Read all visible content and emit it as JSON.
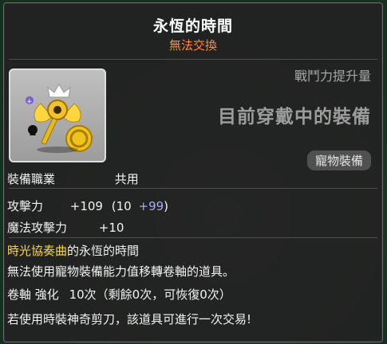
{
  "title": "永恆的時間",
  "subtitle": "無法交換",
  "power_label": "戰鬥力提升量",
  "equip_status": "目前穿戴中的裝備",
  "category_badge": "寵物裝備",
  "job": {
    "label": "裝備職業",
    "value": "共用"
  },
  "attack": {
    "label": "攻擊力",
    "total": "+109",
    "base": "(10",
    "bonus": "+99",
    "close": ")"
  },
  "magic": {
    "label": "魔法攻擊力",
    "value": "+10"
  },
  "set_line": {
    "highlight": "時光協奏曲",
    "rest": "的永恆的時間"
  },
  "description": "無法使用寵物裝備能力值移轉卷軸的道具。",
  "upgrade": {
    "label": "卷軸 強化",
    "value": "10次（剩餘0次，可恢復0次）"
  },
  "trade_note": "若使用時裝神奇剪刀，該道具可進行一次交易!",
  "icon": "golden-key-wing-icon",
  "colors": {
    "subtitle": "#ff8a3a",
    "set_name": "#ffd83b",
    "bonus": "#a8a8ff"
  }
}
